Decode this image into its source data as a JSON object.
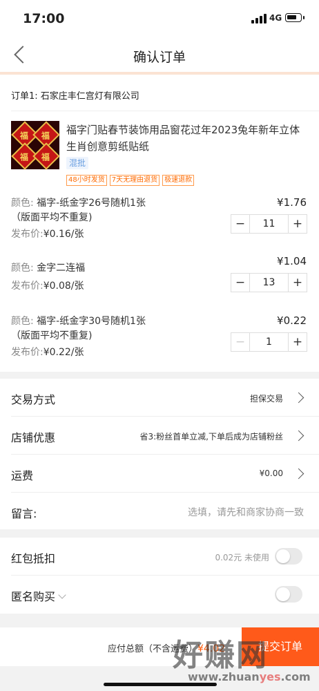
{
  "status_bar": {
    "time": "17:00",
    "network": "4G"
  },
  "nav": {
    "title": "确认订单"
  },
  "order": {
    "shop_line": "订单1: 石家庄丰仁宫灯有限公司"
  },
  "product": {
    "title": "福字门贴春节装饰用品窗花过年2023兔年新年立体生肖创意剪纸贴纸",
    "thumb_text": "福",
    "badge": "混批",
    "tags": [
      "48小时发货",
      "7天无理由退货",
      "极速退款"
    ]
  },
  "skus": [
    {
      "color_key": "颜色:",
      "color_value": "福字-纸金字26号随机1张",
      "color_line2": "（版面平均不重复)",
      "price_key": "发布价:",
      "price_value": "¥0.16/张",
      "total": "¥1.76",
      "qty": "11",
      "minus": "−",
      "plus": "+"
    },
    {
      "color_key": "颜色:",
      "color_value": "金字二连福",
      "price_key": "发布价:",
      "price_value": "¥0.08/张",
      "total": "¥1.04",
      "qty": "13",
      "minus": "−",
      "plus": "+"
    },
    {
      "color_key": "颜色:",
      "color_value": "福字-纸金字30号随机1张",
      "color_line2": "（版面平均不重复)",
      "price_key": "发布价:",
      "price_value": "¥0.22/张",
      "total": "¥0.22",
      "qty": "1",
      "minus": "−",
      "plus": "+"
    }
  ],
  "options": {
    "trade": {
      "label": "交易方式",
      "value": "担保交易"
    },
    "promo": {
      "label": "店铺优惠",
      "value": "省3:粉丝首单立减,下单后成为店铺粉丝"
    },
    "shipping": {
      "label": "运费",
      "value": "¥0.00"
    },
    "message": {
      "label": "留言:",
      "placeholder": "选填，请先和商家协商一致"
    }
  },
  "extras": {
    "redpack": {
      "label": "红包抵扣",
      "value": "0.02元 未使用",
      "enabled": false
    },
    "anonymous": {
      "label": "匿名购买",
      "enabled": false
    }
  },
  "footer": {
    "total_label": "应付总额（不含运费）",
    "total_amount": "¥4.02",
    "submit": "提交订单"
  },
  "watermark": {
    "main": "好赚网",
    "url_a": "www.zhuan",
    "url_b": "yes",
    "url_c": ".com"
  }
}
